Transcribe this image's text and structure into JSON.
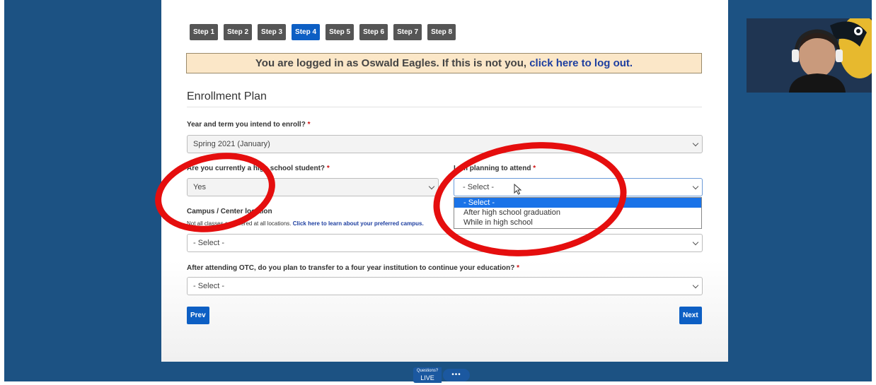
{
  "steps": [
    {
      "label": "Step 1",
      "active": false
    },
    {
      "label": "Step 2",
      "active": false
    },
    {
      "label": "Step 3",
      "active": false
    },
    {
      "label": "Step 4",
      "active": true
    },
    {
      "label": "Step 5",
      "active": false
    },
    {
      "label": "Step 6",
      "active": false
    },
    {
      "label": "Step 7",
      "active": false
    },
    {
      "label": "Step 8",
      "active": false
    }
  ],
  "banner": {
    "text": "You are logged in as Oswald Eagles. If this is not you, ",
    "logout_link": "click here to log out."
  },
  "section_title": "Enrollment Plan",
  "fields": {
    "term": {
      "label": "Year and term you intend to enroll?",
      "required": "*",
      "value": "Spring 2021 (January)"
    },
    "high_school": {
      "label": "Are you currently a high school student?",
      "required": "*",
      "value": "Yes"
    },
    "attend": {
      "label": "I am planning to attend",
      "required": "*",
      "value": "- Select -"
    },
    "campus": {
      "label": "Campus / Center location",
      "note": "Not all classes are offered at all locations. ",
      "note_link": "Click here to learn about your preferred campus.",
      "value": "- Select -"
    },
    "transfer": {
      "label": "After attending OTC, do you plan to transfer to a four year institution to continue your education?",
      "required": "*",
      "value": "- Select -"
    }
  },
  "attend_options": [
    "- Select -",
    "After high school graduation",
    "While in high school"
  ],
  "buttons": {
    "prev": "Prev",
    "next": "Next"
  },
  "live_widget": {
    "questions": "Questions?",
    "live": "LIVE",
    "dots": "•••"
  },
  "colors": {
    "page_bg": "#1c5283",
    "active_step": "#0d5fc4",
    "highlight_ring": "#e50e0e",
    "banner_bg": "#fbe7c8"
  }
}
